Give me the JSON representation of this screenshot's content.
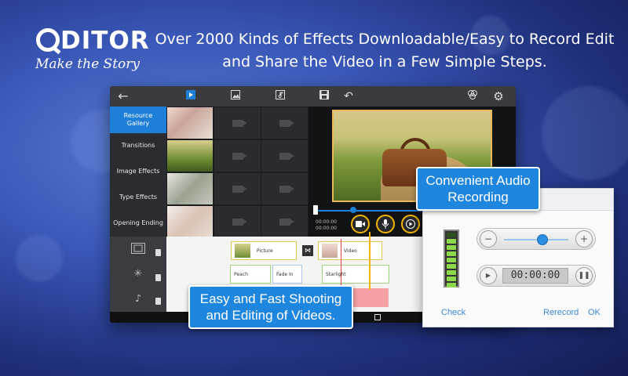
{
  "branding": {
    "logo_q": "Q",
    "logo_rest": "DITOR",
    "tagline": "Make the Story"
  },
  "headline": {
    "line1": "Over 2000 Kinds of Effects Downloadable/Easy to Record Edit",
    "line2": "and Share the Video in a Few Simple Steps."
  },
  "editor": {
    "toolbar_icons": [
      "back-arrow-icon",
      "video-tab-icon",
      "image-tab-icon",
      "music-tab-icon",
      "save-icon",
      "undo-icon",
      "color-filter-icon",
      "settings-gear-icon"
    ],
    "sidebar": [
      {
        "label": "Resource Gallery",
        "active": true
      },
      {
        "label": "Transitions",
        "active": false
      },
      {
        "label": "Image Effects",
        "active": false
      },
      {
        "label": "Type Effects",
        "active": false
      },
      {
        "label": "Opening Ending",
        "active": false
      }
    ],
    "time_current": "00:00:00",
    "time_total": "00:00:00",
    "timeline": {
      "row1": [
        {
          "label": "Picture"
        },
        {
          "label": "Video"
        }
      ],
      "row2": [
        {
          "label": "Peach"
        },
        {
          "label": "Fade In"
        },
        {
          "label": "Starlight"
        }
      ]
    }
  },
  "callouts": {
    "audio_line1": "Convenient Audio",
    "audio_line2": "Recording",
    "shoot_line1": "Easy and Fast Shooting",
    "shoot_line2": "and Editing of Videos."
  },
  "audio_panel": {
    "minus": "−",
    "plus": "+",
    "volume_percent": 60,
    "timer": "00:00:00",
    "check_label": "Check",
    "rerecord_label": "Rerecord",
    "ok_label": "OK",
    "level_bars_lit": 8,
    "level_bars_total": 9
  },
  "colors": {
    "accent": "#1d7fd8",
    "highlight": "#f4b400",
    "meter_green": "#8bd84a"
  }
}
